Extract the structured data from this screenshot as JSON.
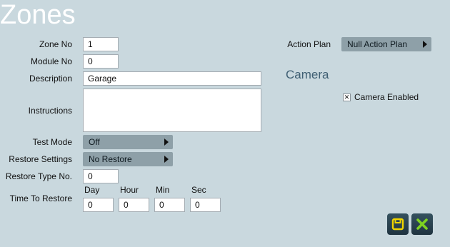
{
  "page": {
    "title": "Zones"
  },
  "form": {
    "zone_no_label": "Zone No",
    "zone_no_value": "1",
    "module_no_label": "Module No",
    "module_no_value": "0",
    "description_label": "Description",
    "description_value": "Garage",
    "instructions_label": "Instructions",
    "instructions_value": "",
    "test_mode_label": "Test Mode",
    "test_mode_value": "Off",
    "restore_settings_label": "Restore Settings",
    "restore_settings_value": "No Restore",
    "restore_type_label": "Restore Type No.",
    "restore_type_value": "0",
    "time_to_restore_label": "Time To Restore",
    "day_label": "Day",
    "day_value": "0",
    "hour_label": "Hour",
    "hour_value": "0",
    "min_label": "Min",
    "min_value": "0",
    "sec_label": "Sec",
    "sec_value": "0"
  },
  "right": {
    "action_plan_label": "Action Plan",
    "action_plan_value": "Null Action Plan",
    "camera_heading": "Camera",
    "camera_enabled_label": "Camera Enabled",
    "camera_enabled_checked": true
  },
  "actions": {
    "save_icon": "save-icon",
    "cancel_icon": "close-icon",
    "save_color": "#f0d400",
    "cancel_color": "#7ed321"
  }
}
